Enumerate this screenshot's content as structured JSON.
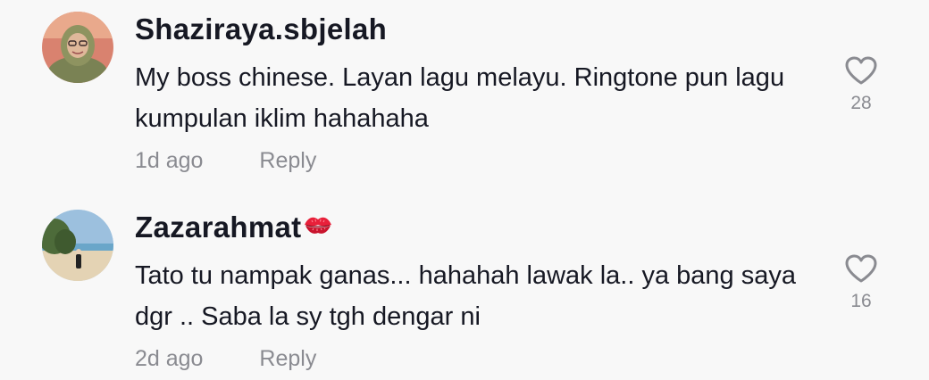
{
  "comments": [
    {
      "username": "Shaziraya.sbjelah",
      "text": "My boss chinese. Layan lagu melayu. Ringtone pun lagu kumpulan iklim hahahaha",
      "time": "1d ago",
      "reply_label": "Reply",
      "likes": "28",
      "emoji": ""
    },
    {
      "username": "Zazarahmat",
      "text": "Tato tu nampak ganas... hahahah lawak la.. ya bang saya dgr .. Saba la sy tgh dengar ni",
      "time": "2d ago",
      "reply_label": "Reply",
      "likes": "16",
      "emoji": "kiss-mark"
    }
  ],
  "colors": {
    "background": "#f8f8f8",
    "username": "#161823",
    "secondary": "#8a8b91",
    "kiss": "#e8203a"
  }
}
